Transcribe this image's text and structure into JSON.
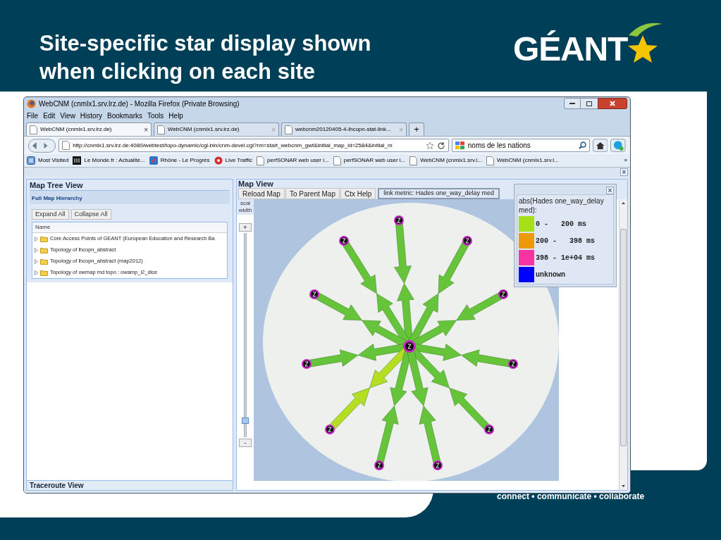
{
  "slide": {
    "title_lines": [
      "Site-specific star display shown",
      "when clicking on each site"
    ],
    "logo": "GÉANT",
    "tagline": "connect • communicate • collaborate"
  },
  "browser": {
    "title": "WebCNM (cnmlx1.srv.lrz.de) - Mozilla Firefox (Private Browsing)",
    "menu": [
      "File",
      "Edit",
      "View",
      "History",
      "Bookmarks",
      "Tools",
      "Help"
    ],
    "tabs": [
      {
        "label": "WebCNM (cnmlx1.srv.lrz.de)",
        "selected": true,
        "close": "×"
      },
      {
        "label": "WebCNM (cnmlx1.srv.lrz.de)",
        "selected": false,
        "close": "×"
      },
      {
        "label": "webcnm20120405-4-lhcopn-stat-link...",
        "selected": false,
        "close": "×"
      }
    ],
    "new_tab": "+",
    "url": "http://cnmlx1.srv.lrz.de:4080/webtest/topo-dynamic/cgi-bin/cnm-devel.cgi?rm=start_webcnm_gwt&initial_map_id=2584&initial_m",
    "search": "noms de les nations",
    "bookmarks": [
      {
        "label": "Most Visited",
        "kind": "most-visited"
      },
      {
        "label": "Le Monde.fr : Actualité...",
        "kind": "newspaper"
      },
      {
        "label": "Rhône - Le Progrès",
        "kind": "badge"
      },
      {
        "label": "Live Traffic",
        "kind": "traffic"
      },
      {
        "label": "perfSONAR web user i...",
        "kind": "page"
      },
      {
        "label": "perfSONAR web user i...",
        "kind": "page"
      },
      {
        "label": "WebCNM (cnmlx1.srv.l...",
        "kind": "page"
      },
      {
        "label": "WebCNM (cnmlx1.srv.l...",
        "kind": "page"
      }
    ],
    "bookmarks_more": "»"
  },
  "app": {
    "close": "×",
    "map_tree": {
      "title": "Map Tree View",
      "section": "Full Map Hierarchy",
      "buttons": [
        "Expand All",
        "Collapse All"
      ],
      "column": "Name",
      "items": [
        {
          "label": "Core Access Points of GEANT (European Education and Research Ba",
          "expanded": false
        },
        {
          "label": "Topology of lhcopn_abstract",
          "expanded": false
        },
        {
          "label": "Topology of lhcopn_abstract (map2012)",
          "expanded": false
        },
        {
          "label": "Topology of owmap md topo : owamp_i2_dice",
          "expanded": false
        }
      ]
    },
    "traceroute": "Traceroute View",
    "map_view": {
      "title": "Map View",
      "toolbar": [
        "Reload Map",
        "To Parent Map",
        "Ctx Help"
      ],
      "metric": "link metric: Hades one_way_delay med",
      "scale_lines": [
        "scal",
        "width"
      ],
      "zoom_in": "+",
      "zoom_out": "-",
      "zoom": {
        "level": 0.08
      },
      "legend": {
        "title": "abs(Hades one_way_delay med):",
        "close": "×",
        "entries": [
          {
            "label": "0 -   200 ms",
            "color": "#a6e016"
          },
          {
            "label": "200 -   398 ms",
            "color": "#ee9a08"
          },
          {
            "label": "398 - 1e+04 ms",
            "color": "#f633a0"
          },
          {
            "label": "unknown",
            "color": "#0000ff"
          }
        ]
      }
    }
  }
}
